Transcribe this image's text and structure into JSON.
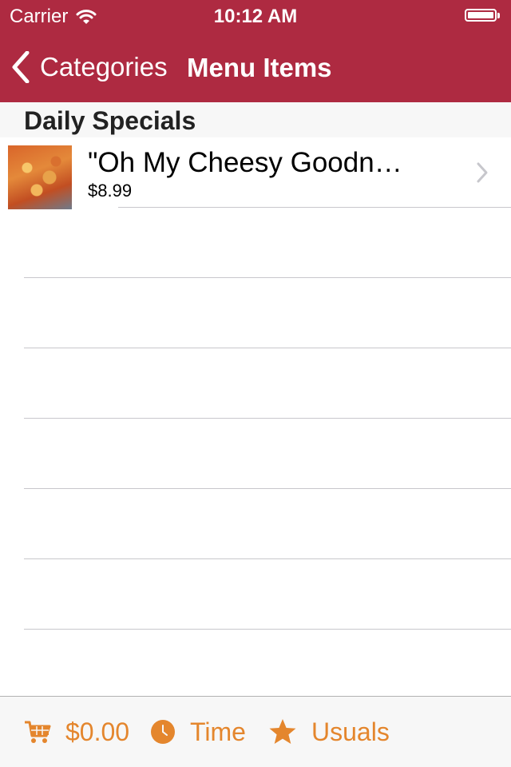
{
  "status_bar": {
    "carrier": "Carrier",
    "time": "10:12 AM"
  },
  "nav": {
    "back_label": "Categories",
    "title": "Menu Items"
  },
  "section": {
    "title": "Daily Specials"
  },
  "items": [
    {
      "name": "\"Oh My Cheesy Goodn…",
      "price": "$8.99"
    }
  ],
  "tab_bar": {
    "cart": "$0.00",
    "time": "Time",
    "usuals": "Usuals"
  },
  "colors": {
    "brand": "#ae2a41",
    "accent": "#e4862d",
    "separator": "#c8c7cc"
  },
  "icons": {
    "status": [
      "wifi-icon",
      "battery-icon"
    ],
    "nav": "chevron-left-icon",
    "row": "chevron-right-icon",
    "tabs": [
      "cart-icon",
      "clock-icon",
      "star-icon"
    ]
  }
}
